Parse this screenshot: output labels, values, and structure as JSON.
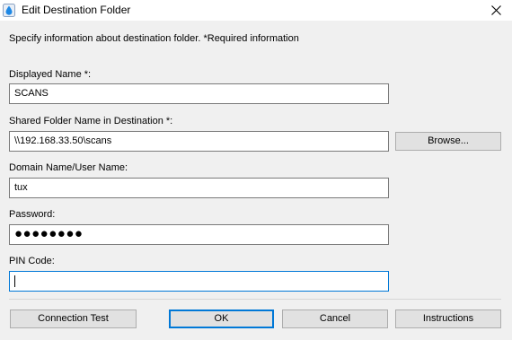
{
  "window": {
    "title": "Edit Destination Folder",
    "app_icon": "water-drop-icon",
    "close_icon": "close-icon"
  },
  "instructions": "Specify information about destination folder. *Required information",
  "fields": {
    "displayed_name": {
      "label": "Displayed Name *:",
      "value": "SCANS"
    },
    "shared_folder": {
      "label": "Shared Folder Name in Destination *:",
      "value": "\\\\192.168.33.50\\scans"
    },
    "domain_user": {
      "label": "Domain Name/User Name:",
      "value": "tux"
    },
    "password": {
      "label": "Password:",
      "value": "●●●●●●●●"
    },
    "pin_code": {
      "label": "PIN Code:",
      "value": ""
    }
  },
  "buttons": {
    "browse": "Browse...",
    "connection_test": "Connection Test",
    "ok": "OK",
    "cancel": "Cancel",
    "instructions": "Instructions"
  },
  "colors": {
    "accent": "#0078d7",
    "dialog_bg": "#f0f0f0",
    "button_bg": "#e1e1e1"
  }
}
